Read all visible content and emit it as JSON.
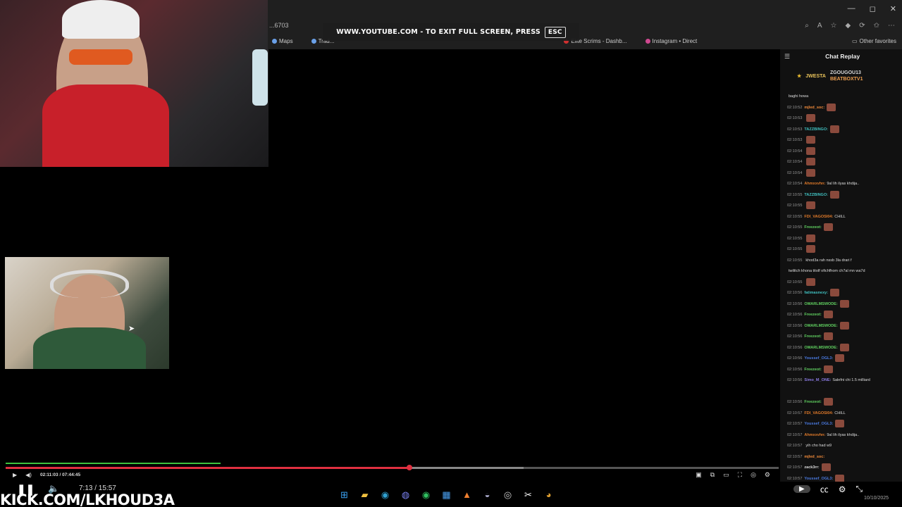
{
  "browser": {
    "url": "...6703",
    "window_buttons": [
      "—",
      "◻",
      "✕"
    ],
    "bookmarks": [
      {
        "label": "Maps",
        "icon": "map-pin-icon"
      },
      {
        "label": "Trad...",
        "icon": "chart-icon"
      },
      {
        "label": "Elite Scrims - Dashb...",
        "icon": "es-logo-icon"
      },
      {
        "label": "Instagram • Direct",
        "icon": "instagram-icon"
      }
    ],
    "other_favorites": "Other favorites",
    "fullscreen_notice": "WWW.YOUTUBE.COM - TO EXIT FULL SCREEN, PRESS",
    "esc_key": "ESC"
  },
  "chat": {
    "title": "Chat Replay",
    "leaderboard": {
      "first": "JWESTA",
      "second": "ZGOUGOU13",
      "third": "BEATBOXTV1"
    },
    "messages": [
      {
        "time": "",
        "user": "",
        "text": "baghi howa",
        "color": "#dddddd",
        "emote": false
      },
      {
        "time": "02:10:52",
        "user": "mjled_soc:",
        "text": "",
        "color": "#f08a3a",
        "emote": true
      },
      {
        "time": "02:10:53",
        "user": "",
        "text": "",
        "color": "#e03040",
        "emote": true
      },
      {
        "time": "02:10:53",
        "user": "TAZZBINGO:",
        "text": "",
        "color": "#40c0c0",
        "emote": true
      },
      {
        "time": "02:10:53",
        "user": "",
        "text": "",
        "color": "#e03040",
        "emote": true
      },
      {
        "time": "02:10:54",
        "user": "",
        "text": "",
        "color": "#e03040",
        "emote": true
      },
      {
        "time": "02:10:54",
        "user": "",
        "text": "",
        "color": "#e03040",
        "emote": true
      },
      {
        "time": "02:10:54",
        "user": "",
        "text": "",
        "color": "#e03040",
        "emote": true
      },
      {
        "time": "02:10:54",
        "user": "Ahmxxvhn:",
        "text": "9al lih ilyas khdija..",
        "color": "#e07a2a",
        "emote": false
      },
      {
        "time": "02:10:55",
        "user": "TAZZBINGO:",
        "text": "",
        "color": "#40c0c0",
        "emote": true
      },
      {
        "time": "02:10:55",
        "user": "",
        "text": "",
        "color": "#4a7ae0",
        "emote": true
      },
      {
        "time": "02:10:55",
        "user": "FDI_VAGOSI04:",
        "text": "CHILL",
        "color": "#e07a2a",
        "emote": false
      },
      {
        "time": "02:10:55",
        "user": "Freezeot:",
        "text": "",
        "color": "#60d060",
        "emote": true
      },
      {
        "time": "02:10:55",
        "user": "",
        "text": "",
        "color": "#4a7ae0",
        "emote": true
      },
      {
        "time": "02:10:55",
        "user": "",
        "text": "",
        "color": "#4a7ae0",
        "emote": true
      },
      {
        "time": "02:10:55",
        "user": "",
        "text": "khod3a rah nssb 3la drari f",
        "color": "#d060d0",
        "emote": false
      },
      {
        "time": "",
        "user": "",
        "text": "twilitch khona titolf ofichfhom ch7al mn wa7d",
        "color": "#dddddd",
        "emote": false
      },
      {
        "time": "02:10:55",
        "user": "",
        "text": "",
        "color": "#4a7ae0",
        "emote": true
      },
      {
        "time": "02:10:56",
        "user": "fatimasnexy:",
        "text": "",
        "color": "#40c0c0",
        "emote": true
      },
      {
        "time": "02:10:56",
        "user": "OMARLMSWODE:",
        "text": "",
        "color": "#60d060",
        "emote": true
      },
      {
        "time": "02:10:56",
        "user": "Freezeot:",
        "text": "",
        "color": "#60d060",
        "emote": true
      },
      {
        "time": "02:10:56",
        "user": "OMARLMSWODE:",
        "text": "",
        "color": "#60d060",
        "emote": true
      },
      {
        "time": "02:10:56",
        "user": "Freezeot:",
        "text": "",
        "color": "#60d060",
        "emote": true
      },
      {
        "time": "02:10:56",
        "user": "OMARLMSWODE:",
        "text": "",
        "color": "#60d060",
        "emote": true
      },
      {
        "time": "02:10:56",
        "user": "Youssef_OGL3:",
        "text": "",
        "color": "#4a7ae0",
        "emote": true
      },
      {
        "time": "02:10:56",
        "user": "Freezeot:",
        "text": "",
        "color": "#60d060",
        "emote": true
      },
      {
        "time": "02:10:56",
        "user": "Simo_M_ONE:",
        "text": "Salefni chi 1.5 milliard",
        "color": "#8a7ae0",
        "emote": false
      },
      {
        "time": "",
        "user": "",
        "text": "",
        "color": "#dddddd",
        "emote": false
      },
      {
        "time": "02:10:56",
        "user": "Freezeot:",
        "text": "",
        "color": "#60d060",
        "emote": true
      },
      {
        "time": "02:10:57",
        "user": "FDI_VAGOSI04:",
        "text": "CHILL",
        "color": "#e07a2a",
        "emote": false
      },
      {
        "time": "02:10:57",
        "user": "Youssef_OGL3:",
        "text": "",
        "color": "#4a7ae0",
        "emote": true
      },
      {
        "time": "02:10:57",
        "user": "Ahmxxvhn:",
        "text": "9al lih ilyas khdija..",
        "color": "#e07a2a",
        "emote": false
      },
      {
        "time": "02:10:57",
        "user": "",
        "text": "yih cho had w9",
        "color": "#4a7ae0",
        "emote": false
      },
      {
        "time": "02:10:57",
        "user": "mjled_soc:",
        "text": "",
        "color": "#f08a3a",
        "emote": false
      },
      {
        "time": "02:10:57",
        "user": "zack3rr:",
        "text": "",
        "color": "#dddddd",
        "emote": true
      },
      {
        "time": "02:10:57",
        "user": "Youssef_OGL3:",
        "text": "",
        "color": "#4a7ae0",
        "emote": true
      }
    ]
  },
  "player": {
    "current_time": "02:11:03 / 07:44:45",
    "progress": 0.522,
    "green_progress": 0.278,
    "buffered": 0.67
  },
  "overlay": {
    "video_time": "7:13 / 15:57",
    "brand": "KICK.COM/LKHOUD3A",
    "date": "10/10/2025"
  },
  "taskbar": {
    "apps": [
      "windows-start-icon",
      "file-explorer-icon",
      "edge-icon",
      "discord-icon",
      "spotify-icon",
      "store-icon",
      "app-icon",
      "steam-icon",
      "obs-icon",
      "capcut-icon",
      "chrome-icon"
    ]
  }
}
